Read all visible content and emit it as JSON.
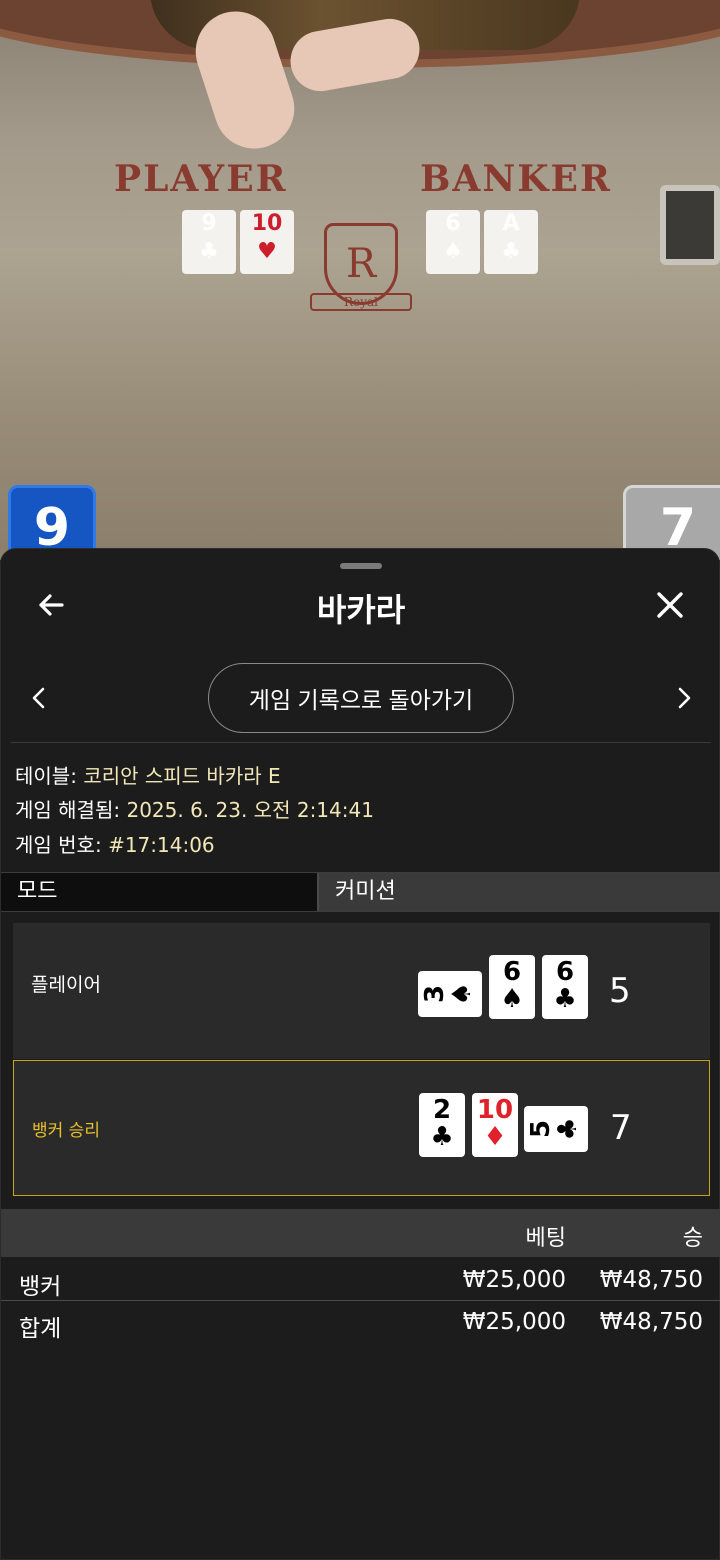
{
  "video": {
    "player_label": "PLAYER",
    "banker_label": "BANKER",
    "crest_letter": "R",
    "crest_text": "Royal",
    "table_cards": {
      "player": [
        {
          "rank": "9",
          "suit": "♣",
          "color": "#000000"
        },
        {
          "rank": "10",
          "suit": "♥",
          "color": "#cc1f2b"
        }
      ],
      "banker": [
        {
          "rank": "6",
          "suit": "♠",
          "color": "#000000"
        },
        {
          "rank": "A",
          "suit": "♣",
          "color": "#000000"
        }
      ]
    },
    "player_score": "9",
    "banker_score": "7"
  },
  "header": {
    "title": "바카라",
    "back_icon": "arrow-left-icon",
    "close_icon": "close-icon"
  },
  "nav": {
    "history_button": "게임 기록으로 돌아가기",
    "prev_icon": "chevron-left-icon",
    "next_icon": "chevron-right-icon"
  },
  "info": {
    "table_label": "테이블:",
    "table_value": "코리안 스피드 바카라 E",
    "resolved_label": "게임 해결됨:",
    "resolved_value": "2025. 6. 23. 오전 2:14:41",
    "game_no_label": "게임 번호:",
    "game_no_value": "#17:14:06"
  },
  "mode": {
    "label": "모드",
    "value": "커미션"
  },
  "results": {
    "player": {
      "label": "플레이어",
      "score": "5",
      "cards": [
        {
          "rank": "3",
          "suit": "♠",
          "orientation": "sideways"
        },
        {
          "rank": "6",
          "suit": "♠",
          "orientation": "upright"
        },
        {
          "rank": "6",
          "suit": "♣",
          "orientation": "upright"
        }
      ]
    },
    "banker": {
      "label": "뱅커 승리",
      "score": "7",
      "cards": [
        {
          "rank": "2",
          "suit": "♣",
          "orientation": "upright"
        },
        {
          "rank": "10",
          "suit": "♦",
          "orientation": "upright",
          "color": "#e0202a"
        },
        {
          "rank": "5",
          "suit": "♣",
          "orientation": "sideways"
        }
      ]
    },
    "winner_accent": "#c8a21a"
  },
  "bets_table": {
    "col_bet": "베팅",
    "col_win": "승",
    "rows": [
      {
        "name": "뱅커",
        "bet": "₩25,000",
        "win": "₩48,750"
      }
    ],
    "total": {
      "name": "합계",
      "bet": "₩25,000",
      "win": "₩48,750"
    }
  }
}
